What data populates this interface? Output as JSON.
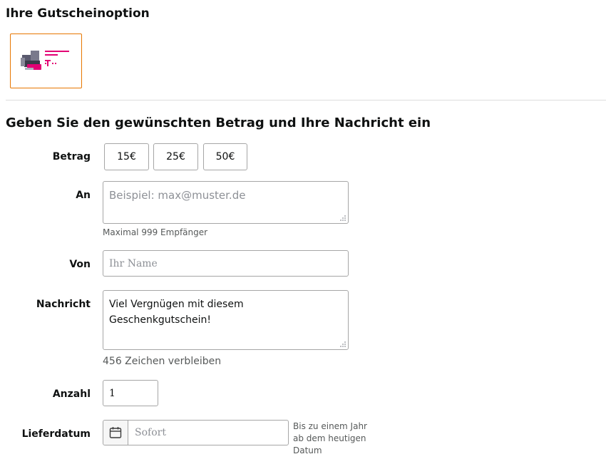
{
  "section_option": {
    "title": "Ihre Gutscheinoption"
  },
  "gift_card": {
    "icon": "telekom-card-thumbnail",
    "brand_color": "#e20074",
    "border_color": "#e77600"
  },
  "section_form": {
    "title": "Geben Sie den gewünschten Betrag und Ihre Nachricht ein"
  },
  "amount": {
    "label": "Betrag",
    "options": [
      "15€",
      "25€",
      "50€"
    ]
  },
  "to": {
    "label": "An",
    "placeholder": "Beispiel: max@muster.de",
    "hint": "Maximal 999 Empfänger"
  },
  "from": {
    "label": "Von",
    "placeholder": "Ihr Name"
  },
  "message": {
    "label": "Nachricht",
    "line1": "Viel Vergnügen mit diesem",
    "line2": "Geschenkgutschein!",
    "remaining": "456 Zeichen verbleiben"
  },
  "quantity": {
    "label": "Anzahl",
    "value": "1"
  },
  "delivery": {
    "label": "Lieferdatum",
    "placeholder": "Sofort",
    "note": "Bis zu einem Jahr ab dem heutigen Datum",
    "icon": "calendar-icon"
  }
}
